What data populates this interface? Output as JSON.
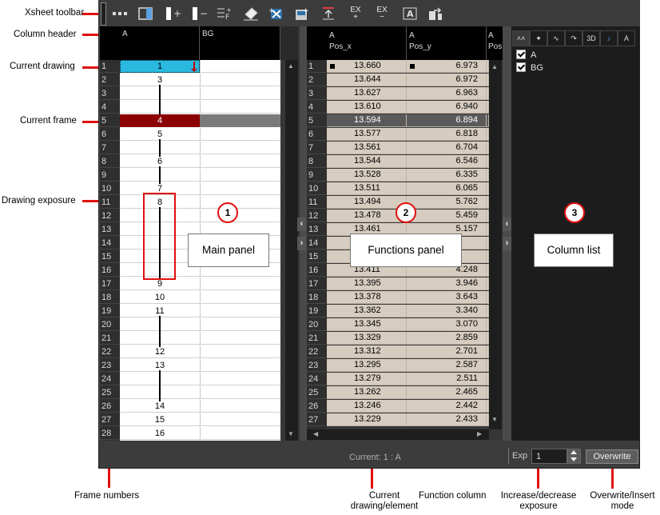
{
  "annotations": {
    "xsheet_toolbar": "Xsheet toolbar",
    "column_header": "Column header",
    "current_drawing": "Current drawing",
    "current_frame": "Current frame",
    "drawing_exposure": "Drawing exposure",
    "frame_numbers": "Frame numbers",
    "current_drawing_element": "Current drawing/element",
    "function_column": "Function column",
    "increase_decrease_exposure": "Increase/decrease exposure",
    "overwrite_insert_mode": "Overwrite/Insert mode"
  },
  "toolbar": {
    "add_exposure": "EX\n+",
    "remove_exposure": "EX\n−"
  },
  "main_panel": {
    "columns": [
      "A",
      "BG"
    ],
    "callout": "Main panel",
    "badge": "1",
    "drawings": [
      {
        "frame": 1,
        "label": "1"
      },
      {
        "frame": 2,
        "label": "3"
      },
      {
        "frame": 5,
        "label": "4"
      },
      {
        "frame": 6,
        "label": "5"
      },
      {
        "frame": 8,
        "label": "6"
      },
      {
        "frame": 10,
        "label": "7"
      },
      {
        "frame": 11,
        "label": "8"
      },
      {
        "frame": 17,
        "label": "9"
      },
      {
        "frame": 18,
        "label": "10"
      },
      {
        "frame": 19,
        "label": "11"
      },
      {
        "frame": 22,
        "label": "12"
      },
      {
        "frame": 23,
        "label": "13"
      },
      {
        "frame": 26,
        "label": "14"
      },
      {
        "frame": 27,
        "label": "15"
      },
      {
        "frame": 28,
        "label": "16"
      }
    ],
    "frames": [
      "1",
      "2",
      "3",
      "4",
      "5",
      "6",
      "7",
      "8",
      "9",
      "10",
      "11",
      "12",
      "13",
      "14",
      "15",
      "16",
      "17",
      "18",
      "19",
      "20",
      "21",
      "22",
      "23",
      "24",
      "25",
      "26",
      "27",
      "28"
    ]
  },
  "functions_panel": {
    "callout": "Functions panel",
    "badge": "2",
    "col1_element": "A",
    "col1_name": "Pos_x",
    "col2_element": "A",
    "col2_name": "Pos_y",
    "col3_element": "A",
    "col3_name": "Pos",
    "frames": [
      "1",
      "2",
      "3",
      "4",
      "5",
      "6",
      "7",
      "8",
      "9",
      "10",
      "11",
      "12",
      "13",
      "14",
      "15",
      "16",
      "17",
      "18",
      "19",
      "20",
      "21",
      "22",
      "23",
      "24",
      "25",
      "26",
      "27"
    ],
    "pos_x": [
      "13.660",
      "13.644",
      "13.627",
      "13.610",
      "13.594",
      "13.577",
      "13.561",
      "13.544",
      "13.528",
      "13.511",
      "13.494",
      "13.478",
      "13.461",
      "",
      "",
      "13.411",
      "13.395",
      "13.378",
      "13.362",
      "13.345",
      "13.329",
      "13.312",
      "13.295",
      "13.279",
      "13.262",
      "13.246",
      "13.229"
    ],
    "pos_y": [
      "6.973",
      "6.972",
      "6.963",
      "6.940",
      "6.894",
      "6.818",
      "6.704",
      "6.546",
      "6.335",
      "6.065",
      "5.762",
      "5.459",
      "5.157",
      "",
      "",
      "4.248",
      "3.946",
      "3.643",
      "3.340",
      "3.070",
      "2.859",
      "2.701",
      "2.587",
      "2.511",
      "2.465",
      "2.442",
      "2.433"
    ]
  },
  "column_list": {
    "callout": "Column list",
    "badge": "3",
    "tabs": [
      "˄˄",
      "✦",
      "∿",
      "↷",
      "3D",
      "♪",
      "A"
    ],
    "items": [
      "A",
      "BG"
    ]
  },
  "status_bar": {
    "current": "Current: 1 : A",
    "exp_label": "Exp",
    "exp_value": "1",
    "overwrite_label": "Overwrite"
  },
  "colors": {
    "current_frame_red": "#8b0000",
    "current_drawing_cyan": "#29b8e0",
    "annotation_red": "#e01010",
    "function_cell": "#d6ccbf"
  }
}
